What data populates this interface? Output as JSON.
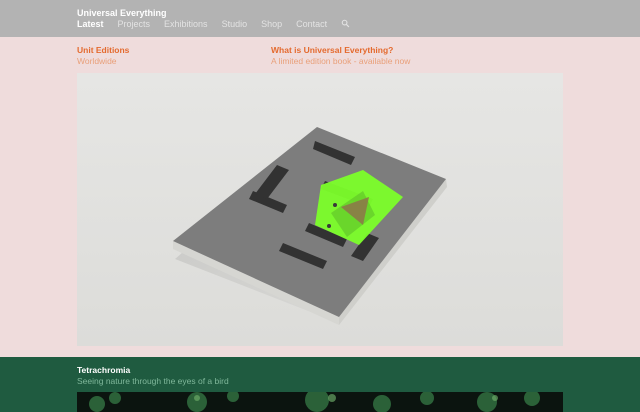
{
  "header": {
    "brand": "Universal Everything",
    "nav": [
      "Latest",
      "Projects",
      "Exhibitions",
      "Studio",
      "Shop",
      "Contact"
    ],
    "active_nav": "Latest",
    "search_icon": "search-icon"
  },
  "feature1": {
    "left_title": "Unit Editions",
    "left_sub": "Worldwide",
    "right_title": "What is Universal Everything?",
    "right_sub": "A limited edition book - available now",
    "image_alt": "Book cover showing large question-mark lettering with neon green overlay"
  },
  "feature2": {
    "title": "Tetrachromia",
    "sub": "Seeing nature through the eyes of a bird"
  },
  "colors": {
    "header_bg": "#b3b3b3",
    "pink_bg": "#efdcdc",
    "accent_orange": "#e46a2e",
    "green_bg": "#1f5b40",
    "neon_green": "#7cff2a"
  }
}
